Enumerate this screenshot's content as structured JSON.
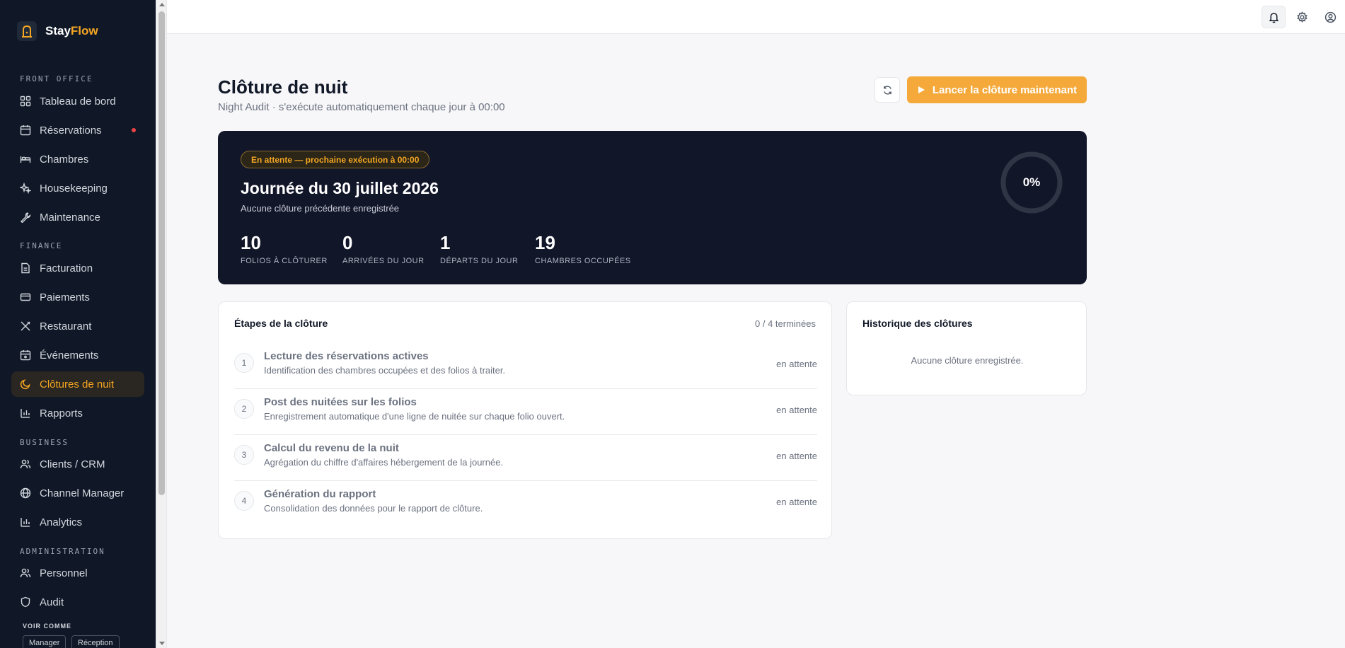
{
  "brand": {
    "name_part1": "Stay",
    "name_part2": "Flow"
  },
  "sidebar": {
    "sections": {
      "front_office": "FRONT OFFICE",
      "finance": "FINANCE",
      "business": "BUSINESS",
      "administration": "ADMINISTRATION"
    },
    "items": {
      "dashboard": "Tableau de bord",
      "reservations": "Réservations",
      "rooms": "Chambres",
      "housekeeping": "Housekeeping",
      "maintenance": "Maintenance",
      "billing": "Facturation",
      "payments": "Paiements",
      "restaurant": "Restaurant",
      "events": "Événements",
      "night_audit": "Clôtures de nuit",
      "reports": "Rapports",
      "crm": "Clients / CRM",
      "channel_manager": "Channel Manager",
      "analytics": "Analytics",
      "staff": "Personnel",
      "audit": "Audit"
    },
    "active_item": "night_audit",
    "voir_comme": {
      "label": "VOIR COMME",
      "roles": [
        "Manager",
        "Réception"
      ]
    }
  },
  "header": {
    "title": "Clôture de nuit",
    "subtitle": "Night Audit · s'exécute automatiquement chaque jour à 00:00",
    "run_button": "Lancer la clôture maintenant"
  },
  "hero": {
    "badge": "En attente — prochaine exécution à 00:00",
    "title": "Journée du 30 juillet 2026",
    "subtitle": "Aucune clôture précédente enregistrée",
    "progress_label": "0%",
    "progress_fraction": 0,
    "stats": [
      {
        "value": "10",
        "label": "FOLIOS À CLÔTURER"
      },
      {
        "value": "0",
        "label": "ARRIVÉES DU JOUR"
      },
      {
        "value": "1",
        "label": "DÉPARTS DU JOUR"
      },
      {
        "value": "19",
        "label": "CHAMBRES OCCUPÉES"
      }
    ]
  },
  "steps": {
    "title": "Étapes de la clôture",
    "count": "0 / 4 terminées",
    "items": [
      {
        "num": "1",
        "title": "Lecture des réservations actives",
        "desc": "Identification des chambres occupées et des folios à traiter.",
        "status": "en attente"
      },
      {
        "num": "2",
        "title": "Post des nuitées sur les folios",
        "desc": "Enregistrement automatique d'une ligne de nuitée sur chaque folio ouvert.",
        "status": "en attente"
      },
      {
        "num": "3",
        "title": "Calcul du revenu de la nuit",
        "desc": "Agrégation du chiffre d'affaires hébergement de la journée.",
        "status": "en attente"
      },
      {
        "num": "4",
        "title": "Génération du rapport",
        "desc": "Consolidation des données pour le rapport de clôture.",
        "status": "en attente"
      }
    ]
  },
  "history": {
    "title": "Historique des clôtures",
    "empty": "Aucune clôture enregistrée."
  },
  "colors": {
    "accent": "#f5a623",
    "sidebar_bg": "#101828",
    "hero_bg": "#121629",
    "badge_dot": "#ef4444"
  }
}
